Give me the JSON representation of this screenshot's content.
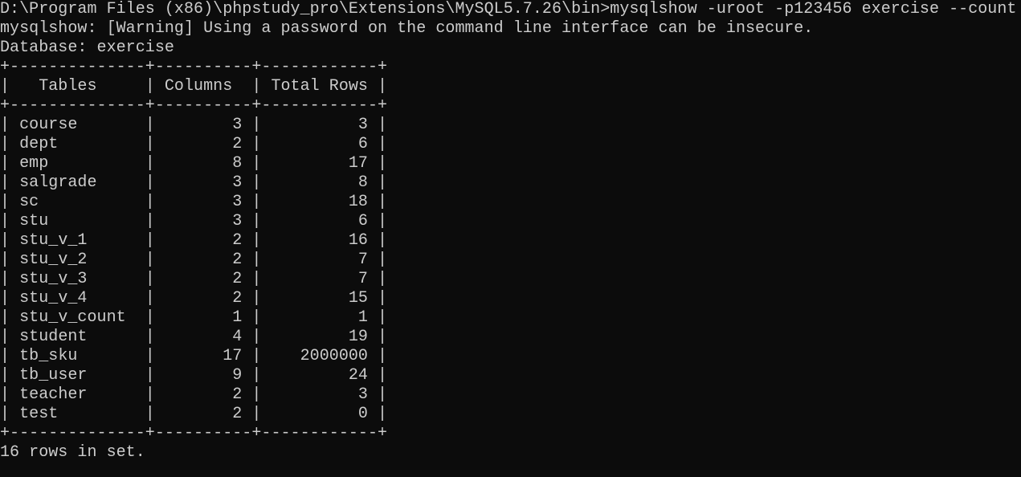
{
  "terminal": {
    "command_line": "D:\\Program Files (x86)\\phpstudy_pro\\Extensions\\MySQL5.7.26\\bin>mysqlshow -uroot -p123456 exercise --count",
    "warning_line": "mysqlshow: [Warning] Using a password on the command line interface can be insecure.",
    "database_line": "Database: exercise",
    "border_line": "+--------------+----------+------------+",
    "header_line": "|   Tables     | Columns  | Total Rows |",
    "table": {
      "headers": [
        "Tables",
        "Columns",
        "Total Rows"
      ],
      "rows": [
        {
          "table": "course",
          "columns": "3",
          "rows": "3"
        },
        {
          "table": "dept",
          "columns": "2",
          "rows": "6"
        },
        {
          "table": "emp",
          "columns": "8",
          "rows": "17"
        },
        {
          "table": "salgrade",
          "columns": "3",
          "rows": "8"
        },
        {
          "table": "sc",
          "columns": "3",
          "rows": "18"
        },
        {
          "table": "stu",
          "columns": "3",
          "rows": "6"
        },
        {
          "table": "stu_v_1",
          "columns": "2",
          "rows": "16"
        },
        {
          "table": "stu_v_2",
          "columns": "2",
          "rows": "7"
        },
        {
          "table": "stu_v_3",
          "columns": "2",
          "rows": "7"
        },
        {
          "table": "stu_v_4",
          "columns": "2",
          "rows": "15"
        },
        {
          "table": "stu_v_count",
          "columns": "1",
          "rows": "1"
        },
        {
          "table": "student",
          "columns": "4",
          "rows": "19"
        },
        {
          "table": "tb_sku",
          "columns": "17",
          "rows": "2000000"
        },
        {
          "table": "tb_user",
          "columns": "9",
          "rows": "24"
        },
        {
          "table": "teacher",
          "columns": "2",
          "rows": "3"
        },
        {
          "table": "test",
          "columns": "2",
          "rows": "0"
        }
      ]
    },
    "summary_line": "16 rows in set.",
    "colors": {
      "background": "#0c0c0c",
      "foreground": "#cccccc"
    }
  }
}
